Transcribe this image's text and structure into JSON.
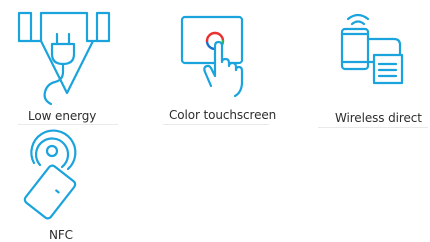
{
  "features": [
    {
      "label": "Low energy",
      "icon": "energy-plug-icon"
    },
    {
      "label": "Color touchscreen",
      "icon": "touchscreen-icon"
    },
    {
      "label": "Wireless direct",
      "icon": "wireless-direct-icon"
    },
    {
      "label": "NFC",
      "icon": "nfc-icon"
    }
  ],
  "colors": {
    "icon_stroke": "#1aa3dc",
    "label_text": "#2d2d2d",
    "touch_red": "#e8322f",
    "touch_green": "#35b44a",
    "touch_blue": "#1a6fd1"
  }
}
